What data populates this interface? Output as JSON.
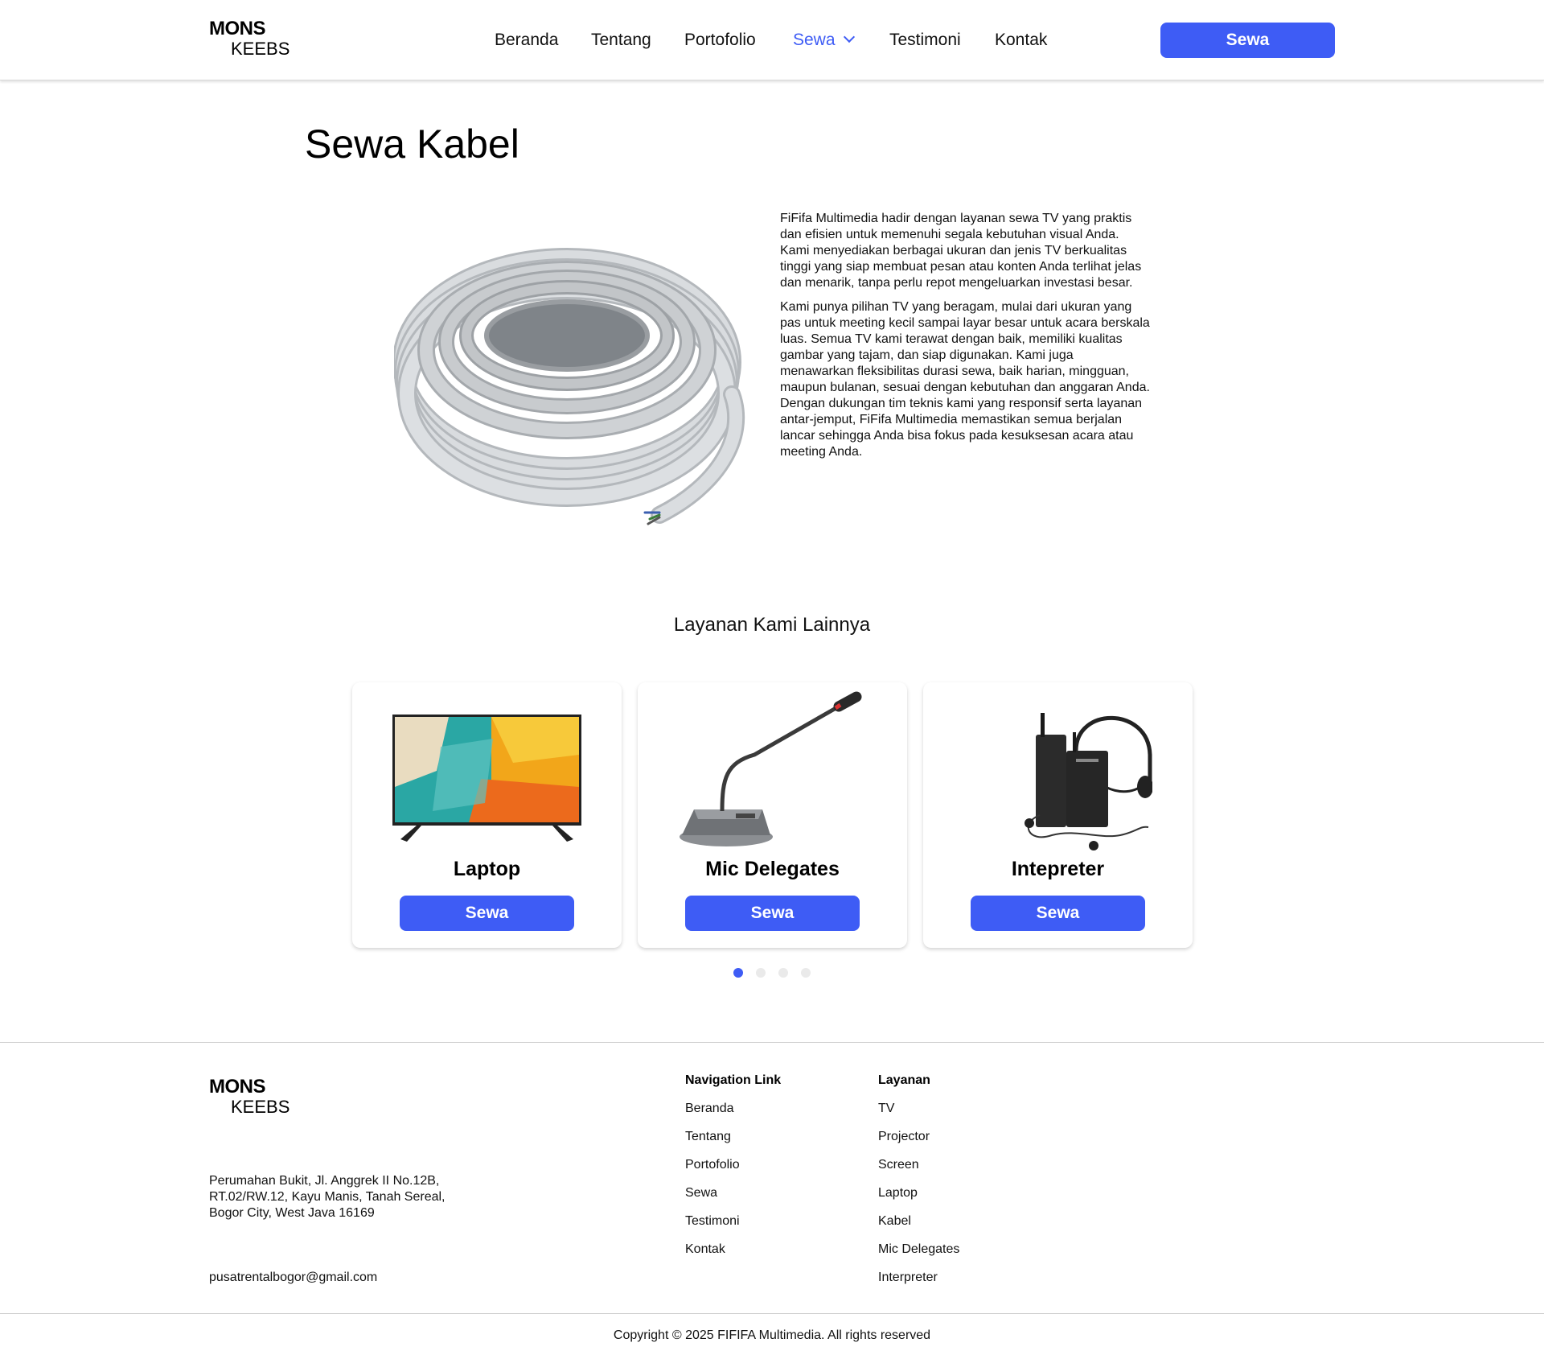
{
  "brand": {
    "line1": "MONS",
    "line2": "KEEBS"
  },
  "nav": {
    "items": [
      "Beranda",
      "Tentang",
      "Portofolio",
      "Sewa",
      "Testimoni",
      "Kontak"
    ],
    "active": "Sewa",
    "cta_label": "Sewa"
  },
  "page": {
    "title": "Sewa Kabel",
    "paragraphs": [
      "FiFifa Multimedia hadir dengan layanan sewa TV yang praktis dan efisien untuk memenuhi segala kebutuhan visual Anda. Kami menyediakan berbagai ukuran dan jenis TV berkualitas tinggi yang siap membuat pesan atau konten Anda terlihat jelas dan menarik, tanpa perlu repot mengeluarkan investasi besar.",
      "Kami punya pilihan TV yang beragam, mulai dari ukuran yang pas untuk meeting kecil sampai layar besar untuk acara berskala luas. Semua TV kami terawat dengan baik, memiliki kualitas gambar yang tajam, dan siap digunakan. Kami juga menawarkan fleksibilitas durasi sewa, baik harian, mingguan, maupun bulanan, sesuai dengan kebutuhan dan anggaran Anda. Dengan dukungan tim teknis kami yang responsif serta layanan antar-jemput, FiFifa Multimedia memastikan semua berjalan lancar sehingga Anda bisa fokus pada kesuksesan acara atau meeting Anda."
    ]
  },
  "services": {
    "title": "Layanan Kami Lainnya",
    "cards": [
      {
        "name": "Laptop",
        "button": "Sewa",
        "icon": "tv-image"
      },
      {
        "name": "Mic Delegates",
        "button": "Sewa",
        "icon": "microphone-image"
      },
      {
        "name": "Intepreter",
        "button": "Sewa",
        "icon": "interpreter-headset-image"
      }
    ],
    "carousel": {
      "total": 4,
      "active_index": 0
    }
  },
  "footer": {
    "address": "Perumahan Bukit, Jl. Anggrek II No.12B, RT.02/RW.12, Kayu Manis, Tanah Sereal, Bogor City, West Java 16169",
    "email": "pusatrentalbogor@gmail.com",
    "nav_heading": "Navigation Link",
    "nav_links": [
      "Beranda",
      "Tentang",
      "Portofolio",
      "Sewa",
      "Testimoni",
      "Kontak"
    ],
    "services_heading": "Layanan",
    "services_links": [
      "TV",
      "Projector",
      "Screen",
      "Laptop",
      "Kabel",
      "Mic Delegates",
      "Interpreter"
    ],
    "copyright": "Copyright © 2025 FIFIFA Multimedia. All rights reserved"
  },
  "colors": {
    "accent": "#3e5cf5",
    "dot_inactive": "#eaeaea"
  }
}
